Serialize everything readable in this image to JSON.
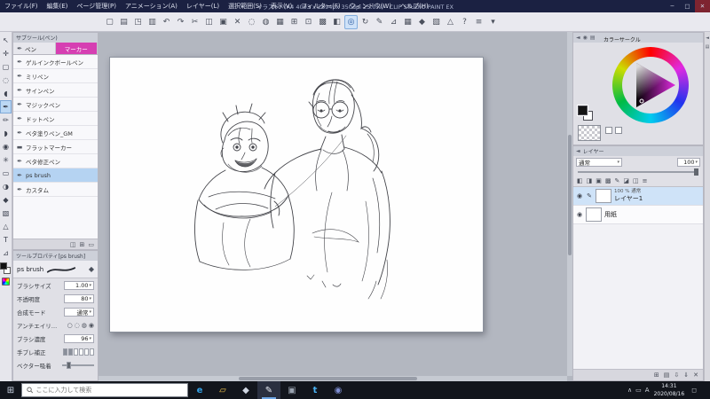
{
  "titlebar": {
    "title": "イラスト* (A4 4093 x 2894px 350dpi 25.0%) - CLIP STUDIO PAINT EX",
    "menus": [
      {
        "label": "ファイル(F)"
      },
      {
        "label": "編集(E)"
      },
      {
        "label": "ページ管理(P)"
      },
      {
        "label": "アニメーション(A)"
      },
      {
        "label": "レイヤー(L)"
      },
      {
        "label": "選択範囲(S)"
      },
      {
        "label": "表示(V)"
      },
      {
        "label": "フィルター(F)"
      },
      {
        "label": "ウィンドウ(W)"
      },
      {
        "label": "ヘルプ(H)"
      }
    ],
    "window_controls": {
      "minimize": "─",
      "maximize": "□",
      "close": "✕"
    }
  },
  "ui": {
    "dropdown_arrow": "▾"
  },
  "toolbar": {
    "icons": [
      {
        "name": "new-canvas-icon",
        "glyph": "▢"
      },
      {
        "name": "open-file-icon",
        "glyph": "▤"
      },
      {
        "name": "save-icon",
        "glyph": "◳"
      },
      {
        "name": "print-icon",
        "glyph": "▥"
      },
      {
        "name": "undo-icon",
        "glyph": "↶"
      },
      {
        "name": "redo-icon",
        "glyph": "↷"
      },
      {
        "name": "cut-icon",
        "glyph": "✂"
      },
      {
        "name": "copy-icon",
        "glyph": "◫"
      },
      {
        "name": "paste-icon",
        "glyph": "▣"
      },
      {
        "name": "delete-icon",
        "glyph": "✕"
      },
      {
        "name": "deselect-icon",
        "glyph": "◌"
      },
      {
        "name": "invert-selection-icon",
        "glyph": "◍"
      },
      {
        "name": "selection-launcher-icon",
        "glyph": "▦"
      },
      {
        "name": "snap-ruler-icon",
        "glyph": "⊞"
      },
      {
        "name": "snap-special-ruler-icon",
        "glyph": "⊡"
      },
      {
        "name": "snap-grid-icon",
        "glyph": "▩"
      },
      {
        "name": "flip-view-icon",
        "glyph": "◧"
      },
      {
        "name": "zoom-fit-icon",
        "glyph": "◎",
        "selected": true
      },
      {
        "name": "rotate-view-icon",
        "glyph": "↻"
      },
      {
        "name": "correct-line-icon",
        "glyph": "✎"
      },
      {
        "name": "ruler-icon",
        "glyph": "⊿"
      },
      {
        "name": "grid-icon",
        "glyph": "▦"
      },
      {
        "name": "material-icon",
        "glyph": "◆"
      },
      {
        "name": "gradient-icon",
        "glyph": "▧"
      },
      {
        "name": "figure-icon",
        "glyph": "△"
      },
      {
        "name": "help-icon",
        "glyph": "?"
      },
      {
        "name": "toolbar-menu-icon",
        "glyph": "≡"
      },
      {
        "name": "toolbar-dropdown-icon",
        "glyph": "▾"
      }
    ]
  },
  "left_toolbar": {
    "main_color": "#111111",
    "sub_color": "#ffffff",
    "tools": [
      {
        "name": "operation-tool-icon",
        "glyph": "↖"
      },
      {
        "name": "layer-move-tool-icon",
        "glyph": "✛"
      },
      {
        "name": "marquee-tool-icon",
        "glyph": "▢"
      },
      {
        "name": "auto-select-tool-icon",
        "glyph": "◌"
      },
      {
        "name": "eyedropper-tool-icon",
        "glyph": "◖"
      },
      {
        "name": "pen-tool-icon",
        "glyph": "✒",
        "selected": true
      },
      {
        "name": "pencil-tool-icon",
        "glyph": "✏"
      },
      {
        "name": "brush-tool-icon",
        "glyph": "◗"
      },
      {
        "name": "airbrush-tool-icon",
        "glyph": "◉"
      },
      {
        "name": "decoration-tool-icon",
        "glyph": "✳"
      },
      {
        "name": "eraser-tool-icon",
        "glyph": "▭"
      },
      {
        "name": "blend-tool-icon",
        "glyph": "◑"
      },
      {
        "name": "fill-tool-icon",
        "glyph": "◆"
      },
      {
        "name": "gradient-tool-icon",
        "glyph": "▧"
      },
      {
        "name": "figure-tool-icon",
        "glyph": "△"
      },
      {
        "name": "text-tool-icon",
        "glyph": "T"
      },
      {
        "name": "ruler-tool-icon",
        "glyph": "⊿"
      }
    ]
  },
  "subtool_panel": {
    "title": "サブツール(ペン)",
    "tabs": [
      {
        "label": "ペン",
        "glyph": "✒"
      },
      {
        "label": "マーカー"
      }
    ],
    "items": [
      {
        "glyph": "✒",
        "label": "ゲルインクボールペン"
      },
      {
        "glyph": "✒",
        "label": "ミリペン"
      },
      {
        "glyph": "✒",
        "label": "サインペン"
      },
      {
        "glyph": "✒",
        "label": "マジックペン"
      },
      {
        "glyph": "✒",
        "label": "ドットペン"
      },
      {
        "glyph": "✒",
        "label": "ベタ塗りペン_GM"
      },
      {
        "glyph": "▬",
        "label": "フラットマーカー"
      },
      {
        "glyph": "✒",
        "label": "ベタ修正ペン"
      },
      {
        "glyph": "✒",
        "label": "ps brush",
        "selected": true
      },
      {
        "glyph": "✒",
        "label": "カスタム"
      }
    ],
    "footer_icons": [
      {
        "name": "duplicate-subtool-icon",
        "glyph": "◫"
      },
      {
        "name": "new-subtool-icon",
        "glyph": "⊞"
      },
      {
        "name": "delete-subtool-icon",
        "glyph": "▭"
      }
    ]
  },
  "tool_property": {
    "title": "ツールプロパティ[ps brush]",
    "preset_name": "ps brush",
    "brush_size_label": "ブラシサイズ",
    "brush_size_value": "1.00",
    "opacity_label": "不透明度",
    "opacity_value": "80",
    "blend_label": "合成モード",
    "blend_value": "通常",
    "aa_label": "アンチエイリアス",
    "density_label": "ブラシ濃度",
    "density_value": "96",
    "stabilize_label": "手ブレ補正",
    "vector_label": "ベクター吸着"
  },
  "color_panel": {
    "title": "カラーサークル",
    "header_icons": [
      {
        "name": "dock-collapse-icon",
        "glyph": "◄"
      },
      {
        "name": "color-wheel-tab-icon",
        "glyph": "◉"
      },
      {
        "name": "color-slider-tab-icon",
        "glyph": "▤"
      }
    ],
    "main_color": "#141414",
    "sub_color": "#ffffff"
  },
  "layer_panel": {
    "title": "レイヤー",
    "blend_mode": "通常",
    "opacity_value": "100",
    "eye_glyph": "◉",
    "edit_glyph": "✎",
    "toolbar_icons": [
      {
        "name": "layer-blend-icon",
        "glyph": "◧"
      },
      {
        "name": "clip-at-layer-icon",
        "glyph": "◨"
      },
      {
        "name": "lock-layer-icon",
        "glyph": "▣"
      },
      {
        "name": "lock-transparent-icon",
        "glyph": "▩"
      },
      {
        "name": "set-as-draft-icon",
        "glyph": "✎"
      },
      {
        "name": "layer-color-icon",
        "glyph": "◪"
      },
      {
        "name": "two-pane-view-icon",
        "glyph": "◫"
      },
      {
        "name": "palette-menu-icon",
        "glyph": "≡"
      }
    ],
    "layers": [
      {
        "info": "100 % 通常",
        "name": "レイヤー1",
        "selected": true,
        "editing": true
      },
      {
        "name": "用紙"
      }
    ],
    "footer_icons": [
      {
        "name": "new-layer-icon",
        "glyph": "⊞"
      },
      {
        "name": "new-folder-icon",
        "glyph": "▤"
      },
      {
        "name": "transfer-to-lower-icon",
        "glyph": "⇩"
      },
      {
        "name": "merge-to-lower-icon",
        "glyph": "⇓"
      },
      {
        "name": "delete-layer-icon",
        "glyph": "✕"
      }
    ]
  },
  "right_dock": {
    "icons": [
      {
        "name": "dock-expand-icon",
        "glyph": "◄"
      },
      {
        "name": "dock-panel-icon",
        "glyph": "▤"
      }
    ]
  },
  "taskbar": {
    "start_glyph": "⊞",
    "search_placeholder": "ここに入力して検索",
    "apps": [
      {
        "name": "edge-icon",
        "glyph": "e",
        "color": "#35a3e8"
      },
      {
        "name": "file-explorer-icon",
        "glyph": "▱",
        "color": "#f6c84c"
      },
      {
        "name": "clip-studio-icon",
        "glyph": "◆",
        "color": "#cfd6e2"
      },
      {
        "name": "clip-studio-paint-icon",
        "glyph": "✎",
        "color": "#e8ecf4",
        "selected": true
      },
      {
        "name": "app-icon",
        "glyph": "▣",
        "color": "#9aa3b0"
      },
      {
        "name": "twitter-icon",
        "glyph": "t",
        "color": "#4ab3f4"
      },
      {
        "name": "mail-icon",
        "glyph": "◉",
        "color": "#7f8fd4"
      }
    ],
    "tray_icons": [
      {
        "name": "tray-expand-icon",
        "glyph": "∧"
      },
      {
        "name": "network-icon",
        "glyph": "▭"
      },
      {
        "name": "ime-icon",
        "glyph": "A"
      }
    ],
    "time": "14:31",
    "date": "2020/08/16",
    "action_center_glyph": "◻"
  }
}
